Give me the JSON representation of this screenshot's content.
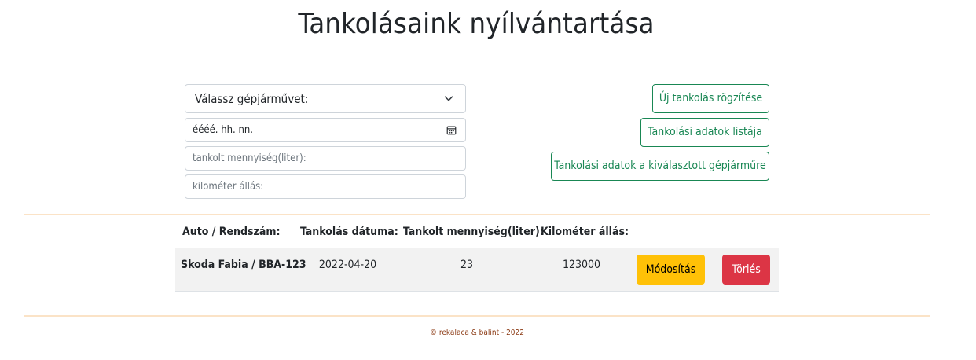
{
  "page": {
    "title": "Tankolásaink nyílvántartása"
  },
  "form": {
    "vehicle_select": {
      "selected": "Válassz gépjárművet:",
      "icon": "chevron-down-icon"
    },
    "date_input": {
      "value": "éééé. hh. nn.",
      "icon": "calendar-icon"
    },
    "liter_input": {
      "placeholder": "tankolt mennyiség(liter):"
    },
    "km_input": {
      "placeholder": "kilométer állás:"
    }
  },
  "actions": {
    "new_refuel": "Új tankolás rögzítése",
    "list_data": "Tankolási adatok listája",
    "selected_vehicle_data": "Tankolási adatok a kiválasztott gépjárműre"
  },
  "table": {
    "headers": [
      "Auto / Rendszám:",
      "Tankolás dátuma:",
      "Tankolt mennyiség(liter):",
      "Kilométer állás:"
    ],
    "rows": [
      {
        "car": "Skoda Fabia / BBA-123",
        "date": "2022-04-20",
        "liters": "23",
        "km": "123000",
        "edit_label": "Módosítás",
        "delete_label": "Törlés"
      }
    ]
  },
  "footer": {
    "text": "© rekalaca & balint - 2022"
  },
  "colors": {
    "outline_success": "#198754",
    "warning": "#ffc107",
    "danger": "#dc3545",
    "divider": "#fbe3c7",
    "footer_text": "#8b3a14"
  }
}
